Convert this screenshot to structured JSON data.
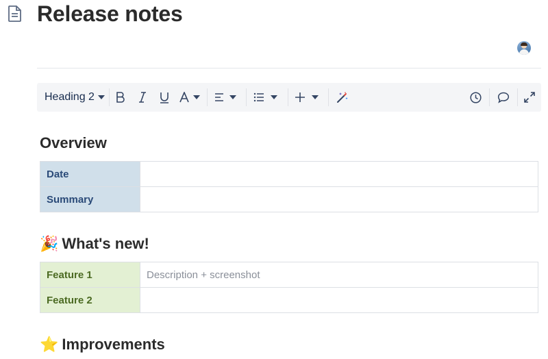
{
  "page": {
    "title": "Release notes"
  },
  "toolbar": {
    "heading_select": "Heading 2",
    "icons": [
      "bold-icon",
      "italic-icon",
      "underline-icon",
      "text-color-icon",
      "align-icon",
      "list-icon",
      "insert-icon",
      "ai-magic-icon",
      "history-icon",
      "comment-icon",
      "fullscreen-icon"
    ]
  },
  "sections": {
    "overview": {
      "heading": "Overview",
      "rows": [
        {
          "label": "Date",
          "value": ""
        },
        {
          "label": "Summary",
          "value": ""
        }
      ],
      "label_color": "#d0dfea"
    },
    "whats_new": {
      "emoji": "🎉",
      "heading": "What's new!",
      "rows": [
        {
          "label": "Feature 1",
          "value": "Description + screenshot"
        },
        {
          "label": "Feature 2",
          "value": ""
        }
      ],
      "label_color": "#e3f0d3"
    },
    "improvements": {
      "emoji": "⭐",
      "heading": "Improvements"
    }
  }
}
